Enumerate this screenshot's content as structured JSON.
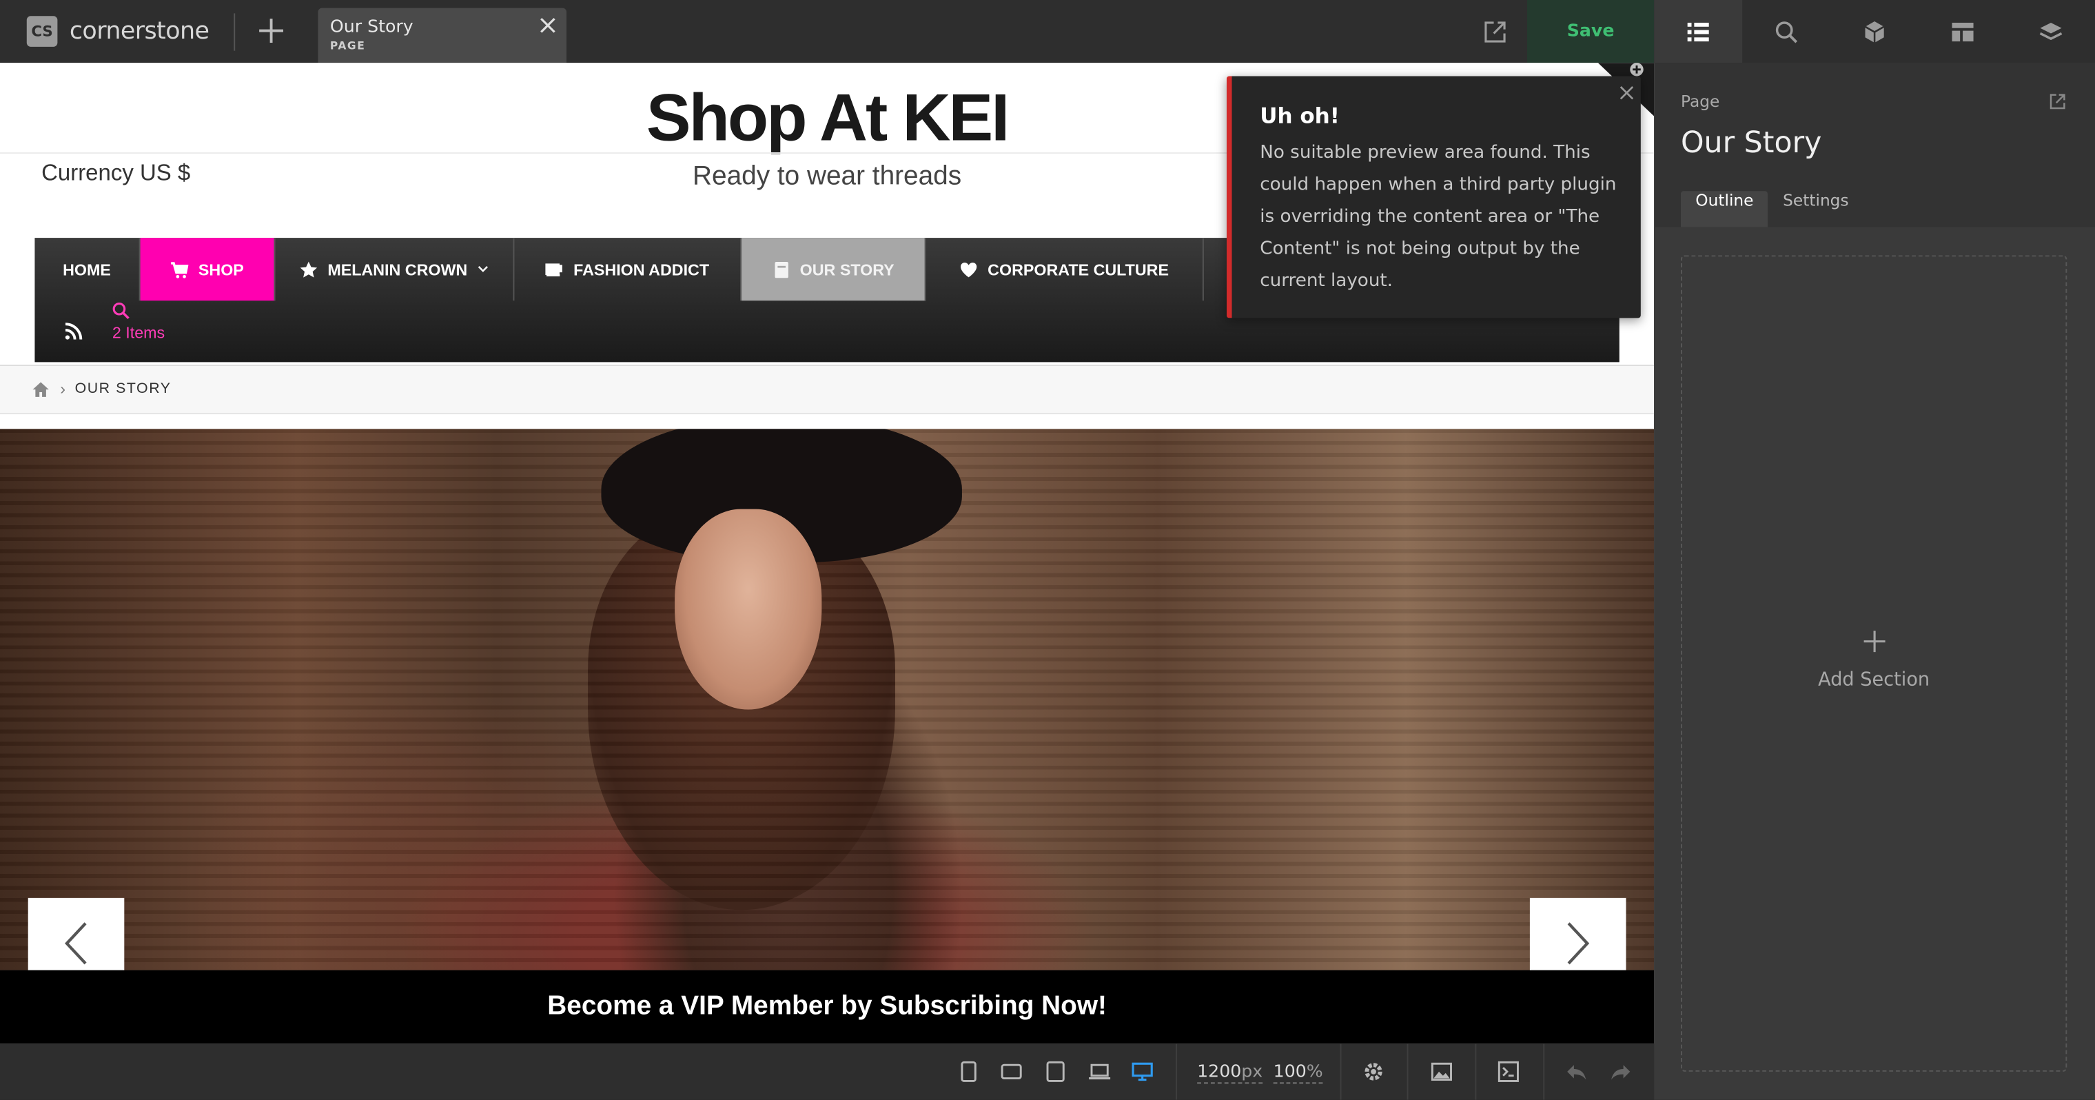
{
  "app": {
    "logo_badge": "CS",
    "logo_text": "cornerstone",
    "tab": {
      "title": "Our Story",
      "subtitle": "PAGE"
    },
    "save_label": "Save"
  },
  "right_panel": {
    "tabs": [
      {
        "icon": "outline-list-icon",
        "active": true
      },
      {
        "icon": "search-icon",
        "active": false
      },
      {
        "icon": "elements-cube-icon",
        "active": false
      },
      {
        "icon": "layout-template-icon",
        "active": false
      },
      {
        "icon": "layers-icon",
        "active": false
      }
    ],
    "label": "Page",
    "title": "Our Story",
    "subtabs": [
      "Outline",
      "Settings"
    ],
    "add_section_label": "Add Section"
  },
  "site": {
    "title": "Shop At KEI",
    "currency": "Currency US $",
    "tagline": "Ready to wear threads",
    "nav": [
      {
        "label": "HOME",
        "icon": ""
      },
      {
        "label": "SHOP",
        "icon": "cart-icon"
      },
      {
        "label": "MELANIN CROWN",
        "icon": "star-icon"
      },
      {
        "label": "FASHION ADDICT",
        "icon": "mug-icon"
      },
      {
        "label": "OUR STORY",
        "icon": "book-icon"
      },
      {
        "label": "CORPORATE CULTURE",
        "icon": "heart-icon"
      }
    ],
    "cart_items": "2 Items",
    "breadcrumb": "OUR STORY",
    "banner_text": "Become a VIP Member by Subscribing Now!"
  },
  "notice": {
    "title": "Uh oh!",
    "message": "No suitable preview area found. This could happen when a third party plugin is overriding the content area or \"The Content\" is not being output by the current layout."
  },
  "toolbar": {
    "width_value": "1200",
    "width_unit": "px",
    "zoom_value": "100",
    "zoom_unit": "%"
  },
  "colors": {
    "accent_pink": "#ff00b0",
    "save_green": "#3fbf73",
    "alert_red": "#d22b2b",
    "active_blue": "#2f9bf0"
  }
}
